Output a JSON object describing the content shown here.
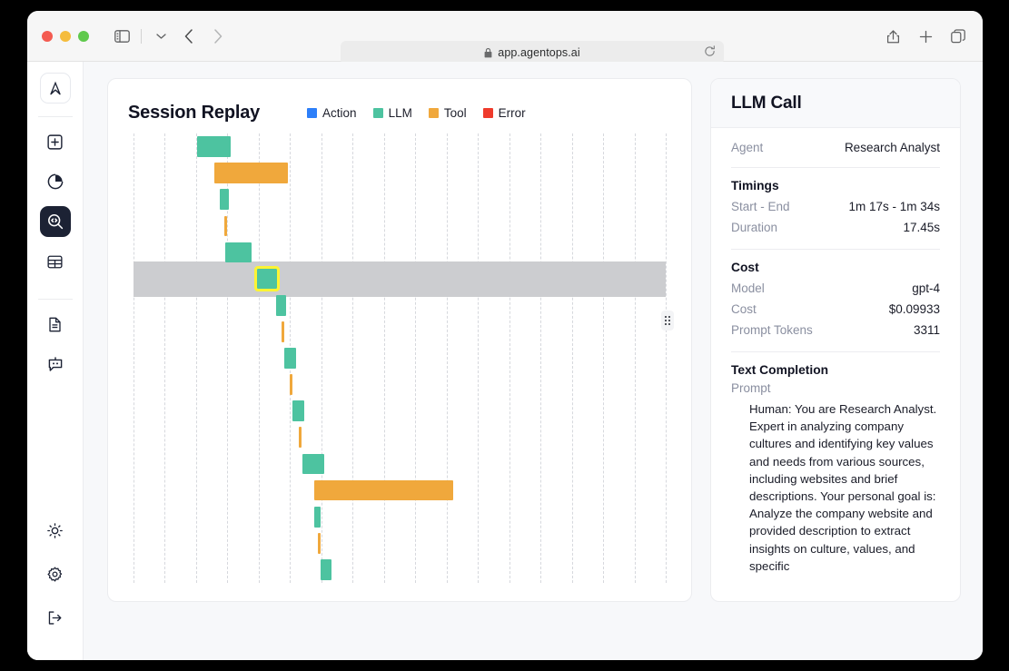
{
  "browser": {
    "url": "app.agentops.ai",
    "lock_icon": "lock-icon",
    "reload_icon": "reload-icon",
    "sidebar_toggle_icon": "sidebar-toggle-icon",
    "chevron_down_icon": "chevron-down-icon",
    "back_icon": "back-arrow-icon",
    "forward_icon": "forward-arrow-icon",
    "share_icon": "share-icon",
    "new_tab_icon": "plus-icon",
    "tabs_icon": "tab-overview-icon"
  },
  "sidebar": {
    "logo_name": "agentops-logo",
    "items": [
      {
        "name": "new-session",
        "icon": "plus-square-icon",
        "active": false
      },
      {
        "name": "overview",
        "icon": "pie-chart-icon",
        "active": false
      },
      {
        "name": "session-replay",
        "icon": "magnifier-code-icon",
        "active": true
      },
      {
        "name": "sessions-table",
        "icon": "table-grid-icon",
        "active": false
      },
      {
        "name": "documents",
        "icon": "document-icon",
        "active": false
      },
      {
        "name": "agents",
        "icon": "bot-icon",
        "active": false
      }
    ],
    "bottom_items": [
      {
        "name": "theme-toggle",
        "icon": "sun-icon"
      },
      {
        "name": "settings",
        "icon": "gear-icon"
      },
      {
        "name": "logout",
        "icon": "logout-icon"
      }
    ]
  },
  "chart_card": {
    "title": "Session Replay",
    "legend": [
      {
        "label": "Action",
        "color": "#2d7ff9"
      },
      {
        "label": "LLM",
        "color": "#4dc3a0"
      },
      {
        "label": "Tool",
        "color": "#f0a83c"
      },
      {
        "label": "Error",
        "color": "#ef3b2c"
      }
    ],
    "resize_handle": "panel-resize-handle"
  },
  "chart_data": {
    "type": "bar",
    "orientation": "horizontal-gantt",
    "title": "Session Replay",
    "xlabel": "",
    "ylabel": "",
    "grid": true,
    "gridlines": 18,
    "legend_position": "top-right",
    "selected_index": 5,
    "selected_row_highlight_color": "#cccdd0",
    "selection_outline_color": "#fcf433",
    "series_colors": {
      "Action": "#2d7ff9",
      "LLM": "#4dc3a0",
      "Tool": "#f0a83c",
      "Error": "#ef3b2c"
    },
    "bars": [
      {
        "type": "LLM",
        "start": 0.12,
        "end": 0.182,
        "row": 0
      },
      {
        "type": "Tool",
        "start": 0.152,
        "end": 0.29,
        "row": 1
      },
      {
        "type": "LLM",
        "start": 0.162,
        "end": 0.18,
        "row": 2
      },
      {
        "type": "Tool",
        "start": 0.17,
        "end": 0.175,
        "row": 3
      },
      {
        "type": "LLM",
        "start": 0.172,
        "end": 0.222,
        "row": 4
      },
      {
        "type": "LLM",
        "start": 0.232,
        "end": 0.27,
        "row": 5
      },
      {
        "type": "LLM",
        "start": 0.268,
        "end": 0.287,
        "row": 6
      },
      {
        "type": "Tool",
        "start": 0.278,
        "end": 0.283,
        "row": 7
      },
      {
        "type": "LLM",
        "start": 0.283,
        "end": 0.305,
        "row": 8
      },
      {
        "type": "Tool",
        "start": 0.293,
        "end": 0.298,
        "row": 9
      },
      {
        "type": "LLM",
        "start": 0.298,
        "end": 0.32,
        "row": 10
      },
      {
        "type": "Tool",
        "start": 0.31,
        "end": 0.315,
        "row": 11
      },
      {
        "type": "LLM",
        "start": 0.318,
        "end": 0.358,
        "row": 12
      },
      {
        "type": "Tool",
        "start": 0.34,
        "end": 0.6,
        "row": 13
      },
      {
        "type": "LLM",
        "start": 0.34,
        "end": 0.352,
        "row": 14
      },
      {
        "type": "Tool",
        "start": 0.347,
        "end": 0.351,
        "row": 15
      },
      {
        "type": "LLM",
        "start": 0.352,
        "end": 0.372,
        "row": 16
      }
    ]
  },
  "detail_panel": {
    "title": "LLM Call",
    "agent": {
      "label": "Agent",
      "value": "Research Analyst"
    },
    "timings": {
      "title": "Timings",
      "rows": [
        {
          "label": "Start - End",
          "value": "1m 17s - 1m 34s"
        },
        {
          "label": "Duration",
          "value": "17.45s"
        }
      ]
    },
    "cost": {
      "title": "Cost",
      "rows": [
        {
          "label": "Model",
          "value": "gpt-4"
        },
        {
          "label": "Cost",
          "value": "$0.09933"
        },
        {
          "label": "Prompt Tokens",
          "value": "3311"
        }
      ]
    },
    "text_completion": {
      "title": "Text Completion",
      "prompt_label": "Prompt",
      "prompt_text": "Human: You are Research Analyst. Expert in analyzing company cultures and identifying key values and needs from various sources, including websites and brief descriptions. Your personal goal is: Analyze the company website and provided description to extract insights on culture, values, and specific"
    }
  }
}
